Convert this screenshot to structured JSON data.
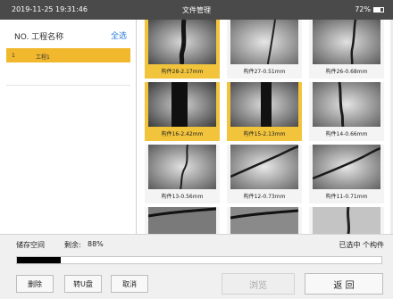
{
  "status": {
    "time": "2019-11-25   19:31:46",
    "title": "文件管理",
    "battery": "72%"
  },
  "left_panel": {
    "header": "NO. 工程名称",
    "select_all": "全选",
    "items": [
      {
        "no": "1",
        "name": "工程1"
      }
    ]
  },
  "tiles": [
    {
      "caption": "构件28-2.17mm",
      "selected": true
    },
    {
      "caption": "构件27-0.51mm",
      "selected": false
    },
    {
      "caption": "构件26-0.68mm",
      "selected": false
    },
    {
      "caption": "构件16-2.42mm",
      "selected": true
    },
    {
      "caption": "构件15-2.13mm",
      "selected": true
    },
    {
      "caption": "构件14-0.66mm",
      "selected": false
    },
    {
      "caption": "构件13-0.56mm",
      "selected": false
    },
    {
      "caption": "构件12-0.73mm",
      "selected": false
    },
    {
      "caption": "构件11-0.71mm",
      "selected": false
    },
    {
      "caption": "",
      "selected": false
    },
    {
      "caption": "",
      "selected": false
    },
    {
      "caption": "",
      "selected": false
    }
  ],
  "bottom": {
    "storage_label": "储存空间",
    "remain_label": "剩余:",
    "remain_value": "88%",
    "used_fraction": 0.12,
    "selected_count": "已选中 个构件",
    "buttons": {
      "delete": "删除",
      "to_usb": "转U盘",
      "cancel": "取消",
      "browse": "浏览",
      "back": "返 回"
    }
  },
  "colors": {
    "accent": "#f1b82e",
    "link": "#2a7bd8"
  }
}
